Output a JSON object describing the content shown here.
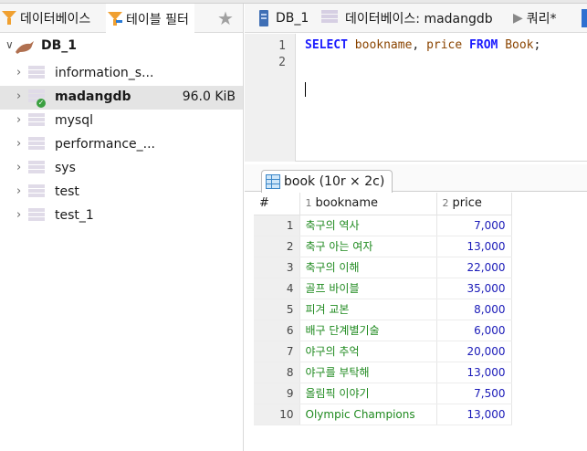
{
  "left_tabs": {
    "database_tab": "데이터베이스",
    "table_filter_tab": "테이블 필터"
  },
  "tree": {
    "root": "DB_1",
    "items": [
      {
        "label": "information_s..."
      },
      {
        "label": "madangdb",
        "size": "96.0 KiB"
      },
      {
        "label": "mysql"
      },
      {
        "label": "performance_..."
      },
      {
        "label": "sys"
      },
      {
        "label": "test"
      },
      {
        "label": "test_1"
      }
    ]
  },
  "right_tabs": {
    "server_tab": "DB_1",
    "database_tab": "데이터베이스: madangdb",
    "query_tab": "쿼리*"
  },
  "editor": {
    "line_numbers": [
      "1",
      "2"
    ],
    "tokens": {
      "select": "SELECT",
      "col1": "bookname",
      "comma": ",",
      "col2": "price",
      "from": "FROM",
      "table": "Book",
      "semi": ";"
    }
  },
  "results": {
    "tab_label": "book (10r × 2c)",
    "columns": [
      {
        "index": "",
        "name": "#"
      },
      {
        "index": "1",
        "name": "bookname"
      },
      {
        "index": "2",
        "name": "price"
      }
    ],
    "rows": [
      {
        "n": "1",
        "bookname": "축구의 역사",
        "price": "7,000"
      },
      {
        "n": "2",
        "bookname": "축구 아는 여자",
        "price": "13,000"
      },
      {
        "n": "3",
        "bookname": "축구의 이해",
        "price": "22,000"
      },
      {
        "n": "4",
        "bookname": "골프 바이블",
        "price": "35,000"
      },
      {
        "n": "5",
        "bookname": "피겨 교본",
        "price": "8,000"
      },
      {
        "n": "6",
        "bookname": "배구 단계별기술",
        "price": "6,000"
      },
      {
        "n": "7",
        "bookname": "야구의 추억",
        "price": "20,000"
      },
      {
        "n": "8",
        "bookname": "야구를 부탁해",
        "price": "13,000"
      },
      {
        "n": "9",
        "bookname": "올림픽 이야기",
        "price": "7,500"
      },
      {
        "n": "10",
        "bookname": "Olympic Champions",
        "price": "13,000"
      }
    ]
  },
  "colors": {
    "keyword": "#1a1aff",
    "identifier": "#8a4400",
    "text_value": "#1f8a1f",
    "number_value": "#1a1ab8"
  }
}
